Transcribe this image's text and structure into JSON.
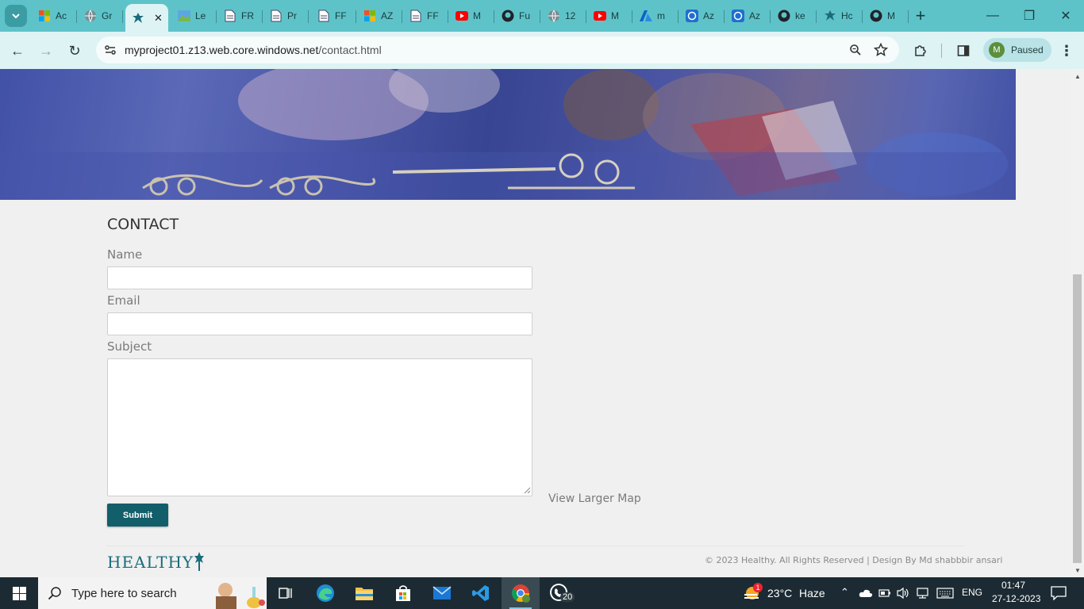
{
  "browser": {
    "tabs": [
      {
        "label": "Ac",
        "icon": "microsoft-icon"
      },
      {
        "label": "Gr",
        "icon": "globe-icon"
      },
      {
        "label": "",
        "icon": "healthy-logo-icon",
        "active": true
      },
      {
        "label": "Le",
        "icon": "landscape-icon"
      },
      {
        "label": "FR",
        "icon": "document-icon"
      },
      {
        "label": "Pr",
        "icon": "document-icon"
      },
      {
        "label": "FF",
        "icon": "document-icon"
      },
      {
        "label": "AZ",
        "icon": "microsoft-icon"
      },
      {
        "label": "FF",
        "icon": "document-icon"
      },
      {
        "label": "M",
        "icon": "youtube-icon"
      },
      {
        "label": "Fu",
        "icon": "github-icon"
      },
      {
        "label": "12",
        "icon": "globe-icon"
      },
      {
        "label": "M",
        "icon": "youtube-icon"
      },
      {
        "label": "m",
        "icon": "azure-icon"
      },
      {
        "label": "Az",
        "icon": "azure-portal-icon"
      },
      {
        "label": "Az",
        "icon": "azure-portal-icon"
      },
      {
        "label": "ke",
        "icon": "github-icon"
      },
      {
        "label": "Hc",
        "icon": "healthy-logo-icon"
      },
      {
        "label": "M",
        "icon": "github-icon"
      }
    ],
    "url_host": "myproject01.z13.web.core.windows.net",
    "url_path": "/contact.html",
    "profile_initial": "M",
    "profile_status": "Paused"
  },
  "page": {
    "contact_title": "CONTACT",
    "name_label": "Name",
    "email_label": "Email",
    "subject_label": "Subject",
    "name_value": "",
    "email_value": "",
    "subject_value": "",
    "submit_label": "Submit",
    "map_link": "View Larger Map",
    "logo_text": "HEALTHY",
    "copyright": "© 2023 Healthy. All Rights Reserved | Design By Md shabbbir ansari"
  },
  "taskbar": {
    "search_placeholder": "Type here to search",
    "weather_temp": "23°C",
    "weather_desc": "Haze",
    "weather_alert": "1",
    "language": "ENG",
    "time": "01:47",
    "date": "27-12-2023",
    "whatsapp_badge": "20"
  },
  "colors": {
    "tab_strip": "#5ec3c9",
    "toolbar": "#ddf3f4",
    "submit_button": "#125e6a",
    "logo": "#1b6c7a",
    "taskbar": "#1c2b33"
  }
}
